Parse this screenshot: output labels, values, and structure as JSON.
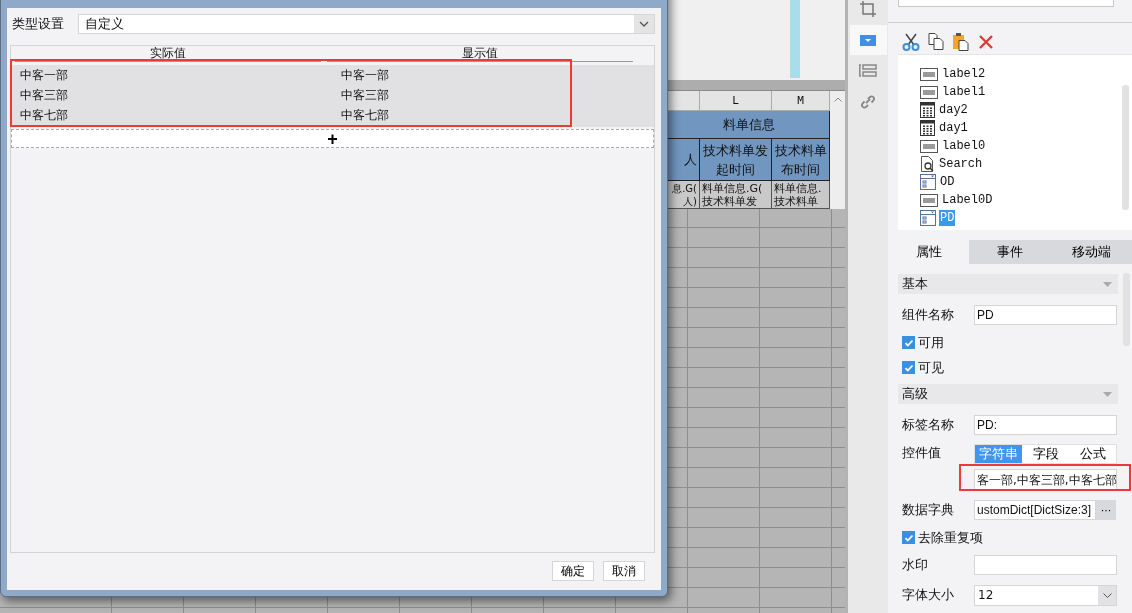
{
  "sheet": {
    "column_headers": [
      "L",
      "M"
    ],
    "group_header": "料单信息",
    "field_headers": [
      [
        "人"
      ],
      [
        "技术料单发",
        "起时间"
      ],
      [
        "技术料单",
        "布时间"
      ]
    ],
    "formula_cells": [
      [
        "息.G(",
        "人)"
      ],
      [
        "料单信息.G(",
        "技术料单发"
      ],
      [
        "料单信息.",
        "技术料单"
      ]
    ]
  },
  "dialog": {
    "type_label": "类型设置",
    "type_value": "自定义",
    "columns": [
      "实际值",
      "显示值"
    ],
    "rows": [
      [
        "中客一部",
        "中客一部"
      ],
      [
        "中客三部",
        "中客三部"
      ],
      [
        "中客七部",
        "中客七部"
      ]
    ],
    "add_symbol": "+",
    "buttons": [
      "确定",
      "取消"
    ]
  },
  "tool_strip": [
    {
      "kind": "crop",
      "selected": false
    },
    {
      "kind": "dropdown",
      "selected": true
    },
    {
      "kind": "form",
      "selected": false
    },
    {
      "kind": "link",
      "selected": false
    }
  ],
  "tree": [
    {
      "kind": "label",
      "name": "label2",
      "selected": false
    },
    {
      "kind": "label",
      "name": "label1",
      "selected": false
    },
    {
      "kind": "date",
      "name": "day2",
      "selected": false
    },
    {
      "kind": "date",
      "name": "day1",
      "selected": false
    },
    {
      "kind": "label",
      "name": "label0",
      "selected": false
    },
    {
      "kind": "search",
      "name": "Search",
      "selected": false
    },
    {
      "kind": "combo",
      "name": "OD",
      "selected": false
    },
    {
      "kind": "label",
      "name": "Label0D",
      "selected": false
    },
    {
      "kind": "combo",
      "name": "PD",
      "selected": true
    }
  ],
  "tabs": [
    {
      "label": "属性",
      "selected": true
    },
    {
      "label": "事件",
      "selected": false
    },
    {
      "label": "移动端",
      "selected": false
    }
  ],
  "properties": [
    {
      "kind": "section",
      "label": "基本"
    },
    {
      "kind": "text",
      "label": "组件名称",
      "value": "PD"
    },
    {
      "kind": "checkbox",
      "label": "可用",
      "checked": true
    },
    {
      "kind": "checkbox",
      "label": "可见",
      "checked": true
    },
    {
      "kind": "section",
      "label": "高级"
    },
    {
      "kind": "text",
      "label": "标签名称",
      "value": "PD:"
    },
    {
      "kind": "segmented",
      "label": "控件值",
      "options": [
        {
          "label": "字符串",
          "selected": true
        },
        {
          "label": "字段",
          "selected": false
        },
        {
          "label": "公式",
          "selected": false
        }
      ]
    },
    {
      "kind": "value",
      "value": "客一部,中客三部,中客七部"
    },
    {
      "kind": "dict",
      "label": "数据字典",
      "value": "ustomDict[DictSize:3]",
      "button": "···"
    },
    {
      "kind": "checkbox",
      "label": "去除重复项",
      "checked": true
    },
    {
      "kind": "text",
      "label": "水印"
    },
    {
      "kind": "select",
      "label": "字体大小",
      "value": "12"
    }
  ]
}
